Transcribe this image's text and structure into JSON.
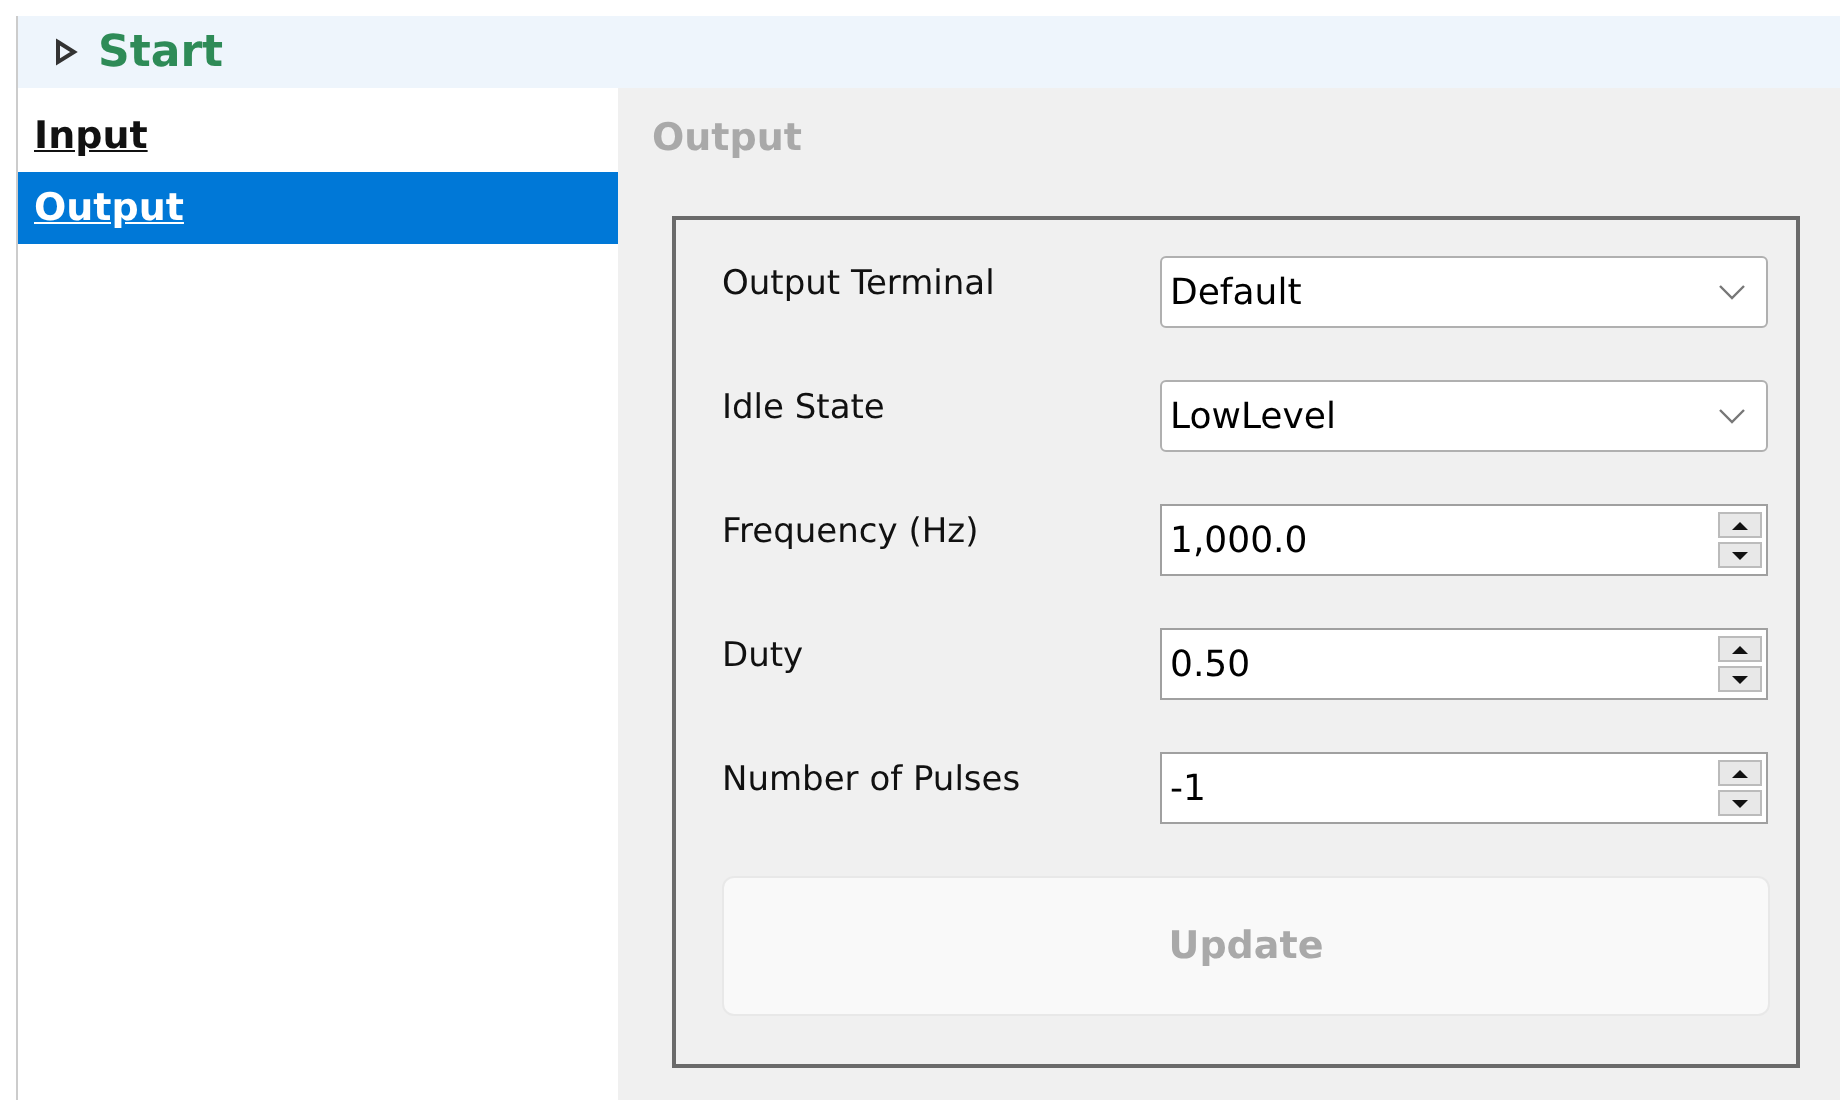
{
  "header": {
    "title": "Start",
    "expanded": false
  },
  "sidebar": {
    "items": [
      {
        "label": "Input",
        "selected": false
      },
      {
        "label": "Output",
        "selected": true
      }
    ]
  },
  "panel": {
    "title": "Output",
    "fields": [
      {
        "label": "Output Terminal",
        "kind": "dropdown",
        "value": "Default"
      },
      {
        "label": "Idle State",
        "kind": "dropdown",
        "value": "LowLevel"
      },
      {
        "label": "Frequency (Hz)",
        "kind": "spin",
        "value": "1,000.0"
      },
      {
        "label": "Duty",
        "kind": "spin",
        "value": "0.50"
      },
      {
        "label": "Number of Pulses",
        "kind": "spin",
        "value": "-1"
      }
    ],
    "button": {
      "label": "Update",
      "disabled": true
    }
  }
}
